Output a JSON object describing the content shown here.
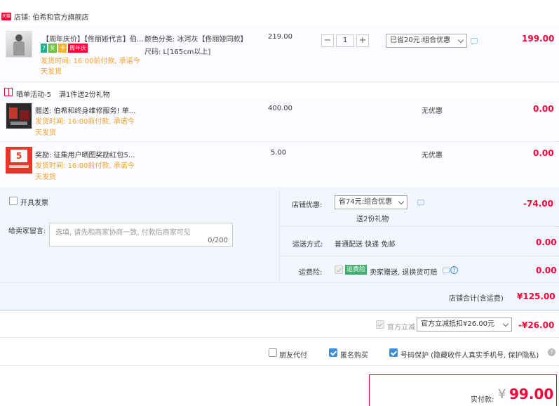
{
  "shop": {
    "badge": "天猫",
    "label": "店铺: 伯希和官方旗舰店"
  },
  "item1": {
    "title": "【周年庆价】【佟丽娅代言】伯...",
    "tags": [
      {
        "text": "7",
        "color": "#19b38d"
      },
      {
        "text": "奖",
        "color": "#67c23a"
      },
      {
        "text": "卡",
        "color": "#f7b32b"
      },
      {
        "text": "周年庆",
        "color": "#ff0036"
      }
    ],
    "sku_color": "颜色分类: 冰河灰【佟丽娅同款】",
    "sku_size": "尺码: L[165cm以上]",
    "ship_time_1": "发货时间: 16:00前付款, 承诺今",
    "ship_time_2": "天发货",
    "price": "219.00",
    "quantity": "1",
    "qty_minus": "−",
    "qty_plus": "+",
    "discount_select": "已省20元:组合优惠",
    "subtotal": "199.00"
  },
  "gift_section": {
    "label": "晒单活动-5",
    "desc": "满1件送2份礼物"
  },
  "gift1": {
    "title": "赠送: 伯希和终身维修服务! 单...",
    "ship_time_1": "发货时间: 16:00前付款, 承诺今",
    "ship_time_2": "天发货",
    "price": "400.00",
    "discount": "无优惠",
    "subtotal": "0.00"
  },
  "gift2": {
    "title": "奖励: 征集用户晒图奖励红包5...",
    "thumb_number": "5",
    "ship_time_1": "发货时间: 16:00前付款, 承诺今",
    "ship_time_2": "天发货",
    "price": "5.00",
    "discount": "无优惠",
    "subtotal": "0.00"
  },
  "invoice": {
    "label": "开具发票"
  },
  "message": {
    "label": "给卖家留言:",
    "placeholder": "选填, 请先和商家协商一致, 付款后商家可见",
    "counter": "0/200"
  },
  "shop_discount": {
    "label": "店铺优惠:",
    "select": "省74元:组合优惠",
    "gift_note": "送2份礼物",
    "amount": "-74.00"
  },
  "shipping": {
    "label": "运送方式:",
    "value": "普通配送 快递 免邮",
    "amount": "0.00"
  },
  "insurance": {
    "label": "运费险:",
    "badge": "运费险",
    "value": "卖家赠送, 退换货可赔",
    "help": "?",
    "amount": "0.00"
  },
  "shop_total": {
    "label": "店铺合计(含运费)",
    "amount": "¥125.00"
  },
  "official": {
    "label": "官方立减",
    "select": "官方立减抵扣¥26.00元",
    "amount": "-¥26.00"
  },
  "options": {
    "friend_pay": "朋友代付",
    "anonymous": "匿名购买",
    "number_protect": "号码保护 (隐藏收件人真实手机号, 保护隐私)",
    "help": "?"
  },
  "payment": {
    "label": "实付款:",
    "currency": "¥",
    "amount": "99.00"
  },
  "colors": {
    "accent": "#ff0036",
    "orange": "#f2a02d",
    "blue": "#3c8cd8",
    "panel": "#f2f6ff"
  }
}
